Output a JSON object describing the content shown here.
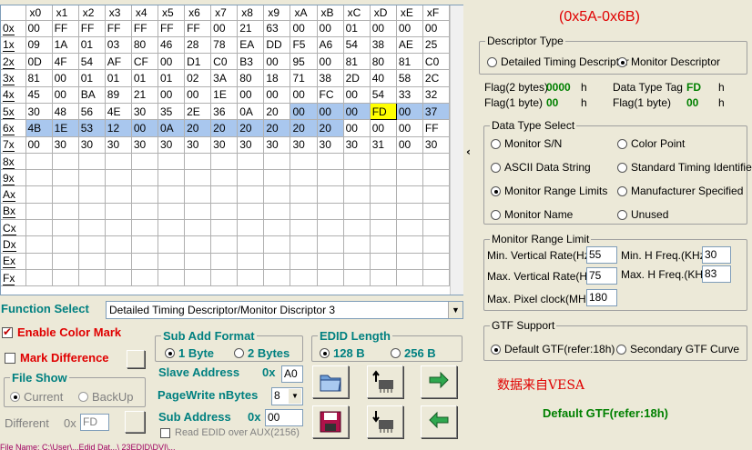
{
  "grid": {
    "col_headers": [
      "x0",
      "x1",
      "x2",
      "x3",
      "x4",
      "x5",
      "x6",
      "x7",
      "x8",
      "x9",
      "xA",
      "xB",
      "xC",
      "xD",
      "xE",
      "xF"
    ],
    "rows": [
      {
        "label": "0x",
        "cells": [
          "00",
          "FF",
          "FF",
          "FF",
          "FF",
          "FF",
          "FF",
          "00",
          "21",
          "63",
          "00",
          "00",
          "01",
          "00",
          "00",
          "00"
        ]
      },
      {
        "label": "1x",
        "cells": [
          "09",
          "1A",
          "01",
          "03",
          "80",
          "46",
          "28",
          "78",
          "EA",
          "DD",
          "F5",
          "A6",
          "54",
          "38",
          "AE",
          "25"
        ]
      },
      {
        "label": "2x",
        "cells": [
          "0D",
          "4F",
          "54",
          "AF",
          "CF",
          "00",
          "D1",
          "C0",
          "B3",
          "00",
          "95",
          "00",
          "81",
          "80",
          "81",
          "C0"
        ]
      },
      {
        "label": "3x",
        "cells": [
          "81",
          "00",
          "01",
          "01",
          "01",
          "01",
          "02",
          "3A",
          "80",
          "18",
          "71",
          "38",
          "2D",
          "40",
          "58",
          "2C"
        ]
      },
      {
        "label": "4x",
        "cells": [
          "45",
          "00",
          "BA",
          "89",
          "21",
          "00",
          "00",
          "1E",
          "00",
          "00",
          "00",
          "FC",
          "00",
          "54",
          "33",
          "32"
        ]
      },
      {
        "label": "5x",
        "cells": [
          "30",
          "48",
          "56",
          "4E",
          "30",
          "35",
          "2E",
          "36",
          "0A",
          "20",
          "00",
          "00",
          "00",
          "FD",
          "00",
          "37"
        ]
      },
      {
        "label": "6x",
        "cells": [
          "4B",
          "1E",
          "53",
          "12",
          "00",
          "0A",
          "20",
          "20",
          "20",
          "20",
          "20",
          "20",
          "00",
          "00",
          "00",
          "FF"
        ]
      },
      {
        "label": "7x",
        "cells": [
          "00",
          "30",
          "30",
          "30",
          "30",
          "30",
          "30",
          "30",
          "30",
          "30",
          "30",
          "30",
          "30",
          "31",
          "00",
          "30"
        ]
      },
      {
        "label": "8x",
        "cells": [
          "",
          "",
          "",
          "",
          "",
          "",
          "",
          "",
          "",
          "",
          "",
          "",
          "",
          "",
          "",
          ""
        ]
      },
      {
        "label": "9x",
        "cells": [
          "",
          "",
          "",
          "",
          "",
          "",
          "",
          "",
          "",
          "",
          "",
          "",
          "",
          "",
          "",
          ""
        ]
      },
      {
        "label": "Ax",
        "cells": [
          "",
          "",
          "",
          "",
          "",
          "",
          "",
          "",
          "",
          "",
          "",
          "",
          "",
          "",
          "",
          ""
        ]
      },
      {
        "label": "Bx",
        "cells": [
          "",
          "",
          "",
          "",
          "",
          "",
          "",
          "",
          "",
          "",
          "",
          "",
          "",
          "",
          "",
          ""
        ]
      },
      {
        "label": "Cx",
        "cells": [
          "",
          "",
          "",
          "",
          "",
          "",
          "",
          "",
          "",
          "",
          "",
          "",
          "",
          "",
          "",
          ""
        ]
      },
      {
        "label": "Dx",
        "cells": [
          "",
          "",
          "",
          "",
          "",
          "",
          "",
          "",
          "",
          "",
          "",
          "",
          "",
          "",
          "",
          ""
        ]
      },
      {
        "label": "Ex",
        "cells": [
          "",
          "",
          "",
          "",
          "",
          "",
          "",
          "",
          "",
          "",
          "",
          "",
          "",
          "",
          "",
          ""
        ]
      },
      {
        "label": "Fx",
        "cells": [
          "",
          "",
          "",
          "",
          "",
          "",
          "",
          "",
          "",
          "",
          "",
          "",
          "",
          "",
          "",
          ""
        ]
      }
    ],
    "selection_color": "#a9c7ee",
    "current_color": "#ffff00"
  },
  "function_select": {
    "label": "Function Select",
    "value": "Detailed Timing Descriptor/Monitor Discriptor 3"
  },
  "enable_color_mark": {
    "label": "Enable Color Mark",
    "checked": true
  },
  "mark_difference": {
    "label": "Mark Difference",
    "checked": false
  },
  "file_show": {
    "legend": "File Show",
    "current": "Current",
    "backup": "BackUp"
  },
  "different": {
    "label": "Different",
    "prefix": "0x",
    "value": "FD"
  },
  "sub_add_format": {
    "legend": "Sub Add Format",
    "opt1": "1 Byte",
    "opt2": "2 Bytes"
  },
  "edid_length": {
    "legend": "EDID Length",
    "opt1": "128 B",
    "opt2": "256 B"
  },
  "slave_address": {
    "label": "Slave Address",
    "prefix": "0x",
    "value": "A0"
  },
  "pagewrite": {
    "label": "PageWrite nBytes",
    "value": "8"
  },
  "sub_address": {
    "label": "Sub Address",
    "prefix": "0x",
    "value": "00"
  },
  "read_edid_aux": {
    "label": "Read EDID over AUX(2156)",
    "checked": false
  },
  "file_name": "File Name: C:\\User\\...Edid Dat...\\ 23EDID\\DVI\\...",
  "right": {
    "title": "(0x5A-0x6B)",
    "descriptor_type": {
      "legend": "Descriptor Type",
      "opt1": "Detailed Timing Descriptor",
      "opt2": "Monitor Descriptor"
    },
    "flag2": {
      "label": "Flag(2 bytes)",
      "value": "0000",
      "unit": "h"
    },
    "flag1a": {
      "label": "Flag(1 byte)",
      "value": "00",
      "unit": "h"
    },
    "data_type_tag": {
      "label": "Data Type Tag",
      "value": "FD",
      "unit": "h"
    },
    "flag1b": {
      "label": "Flag(1 byte)",
      "value": "00",
      "unit": "h"
    },
    "data_type_select": {
      "legend": "Data Type Select",
      "opts": [
        "Monitor S/N",
        "Color Point",
        "ASCII Data String",
        "Standard Timing Identifier",
        "Monitor Range Limits",
        "Manufacturer Specified",
        "Monitor Name",
        "Unused"
      ]
    },
    "monitor_range": {
      "legend": "Monitor Range Limit",
      "min_v": {
        "label": "Min. Vertical Rate(Hz)",
        "value": "55"
      },
      "min_h": {
        "label": "Min. H Freq.(KHz)",
        "value": "30"
      },
      "max_v": {
        "label": "Max. Vertical Rate(Hz)",
        "value": "75"
      },
      "max_h": {
        "label": "Max. H Freq.(KHz)",
        "value": "83"
      },
      "max_pix": {
        "label": "Max. Pixel clock(MHz)",
        "value": "180"
      }
    },
    "gtf": {
      "legend": "GTF Support",
      "opt1": "Default GTF(refer:18h)",
      "opt2": "Secondary GTF Curve"
    },
    "note": "数据来自VESA",
    "gtf_status": "Default GTF(refer:18h)"
  }
}
